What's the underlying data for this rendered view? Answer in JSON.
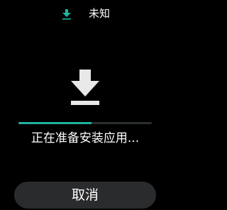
{
  "status_bar": {
    "icon": "download-icon",
    "title": "未知",
    "accent_color": "#1fb39e"
  },
  "main": {
    "icon": "download-icon",
    "progress_fraction": 0.55,
    "status_text": "正在准备安装应用..."
  },
  "actions": {
    "cancel_label": "取消"
  }
}
